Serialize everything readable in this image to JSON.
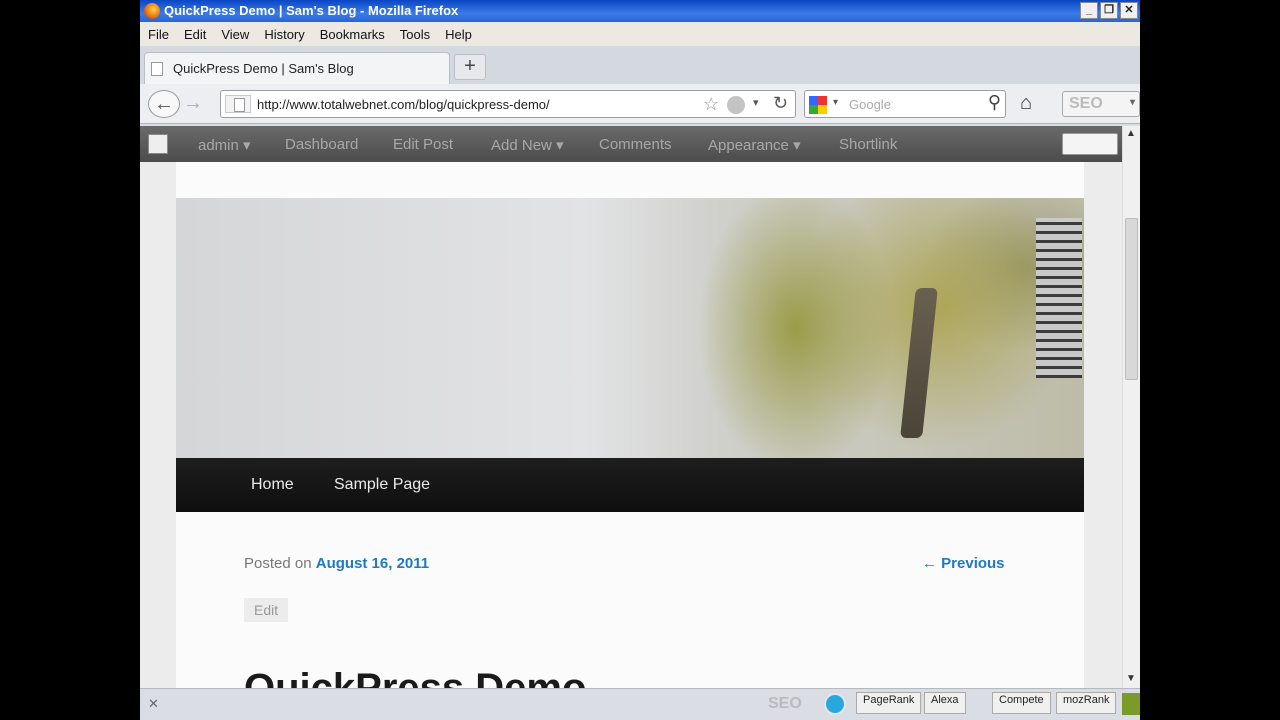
{
  "window": {
    "title": "QuickPress Demo | Sam's Blog - Mozilla Firefox"
  },
  "menu": [
    "File",
    "Edit",
    "View",
    "History",
    "Bookmarks",
    "Tools",
    "Help"
  ],
  "tab": {
    "label": "QuickPress Demo | Sam's Blog"
  },
  "nav": {
    "url": "http://www.totalwebnet.com/blog/quickpress-demo/",
    "search_placeholder": "Google",
    "seo_label": "SEO"
  },
  "admin_bar": {
    "items": [
      "admin ▾",
      "Dashboard",
      "Edit Post",
      "Add New ▾",
      "Comments",
      "Appearance ▾",
      "Shortlink"
    ]
  },
  "site_nav": [
    "Home",
    "Sample Page"
  ],
  "post": {
    "posted_on": "Posted on",
    "date": "August 16, 2011",
    "previous": "← Previous",
    "edit": "Edit",
    "title": "QuickPress Demo"
  },
  "status_bar": {
    "seo_label": "SEO",
    "pills": [
      "PageRank",
      "Alexa",
      "Compete",
      "mozRank"
    ]
  }
}
